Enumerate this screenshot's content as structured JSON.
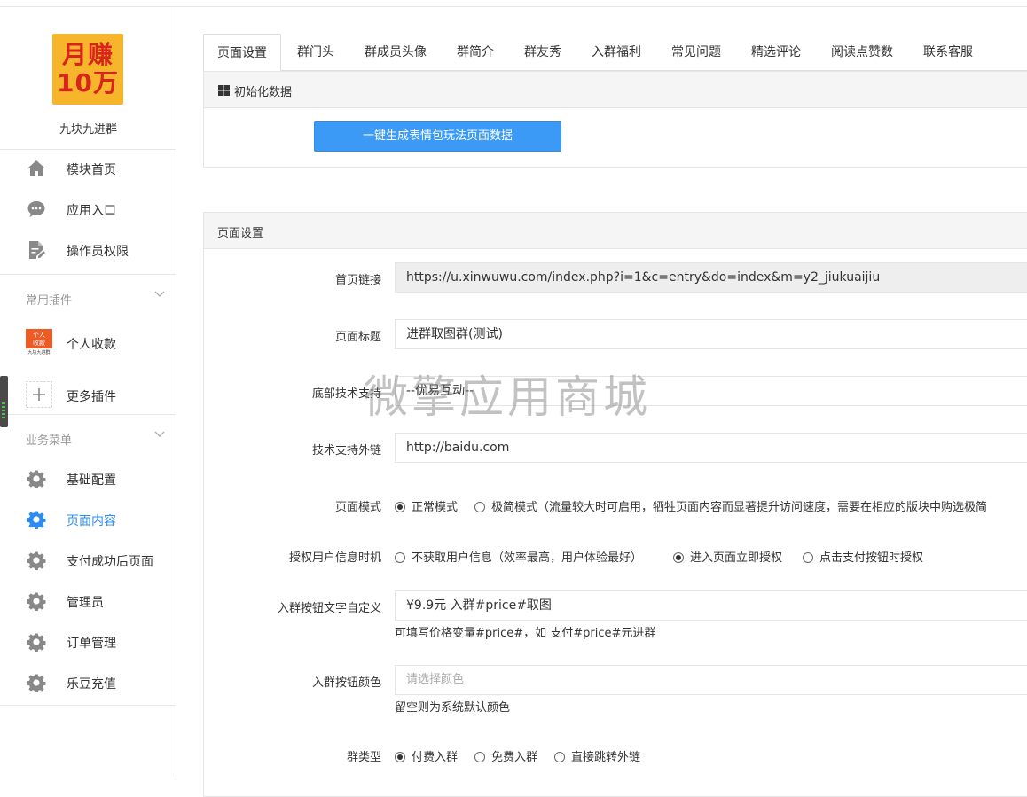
{
  "sidebar": {
    "logo": {
      "line1": "月赚",
      "line2": "10万"
    },
    "brand": "九块九进群",
    "main_items": [
      {
        "label": "模块首页",
        "icon": "home-icon"
      },
      {
        "label": "应用入口",
        "icon": "chat-bubble-icon"
      },
      {
        "label": "操作员权限",
        "icon": "document-edit-icon"
      }
    ],
    "plugins_title": "常用插件",
    "plugins": [
      {
        "label": "个人收款",
        "icon": "personal-payment-icon",
        "icon_text_top": "个人",
        "icon_text_mid": "收款",
        "icon_text_bot": "九块九进群"
      },
      {
        "label": "更多插件",
        "icon": "plus-icon"
      }
    ],
    "business_title": "业务菜单",
    "business_items": [
      {
        "label": "基础配置",
        "icon": "gear-icon",
        "active": false
      },
      {
        "label": "页面内容",
        "icon": "gear-icon",
        "active": true
      },
      {
        "label": "支付成功后页面",
        "icon": "gear-icon",
        "active": false
      },
      {
        "label": "管理员",
        "icon": "gear-icon",
        "active": false
      },
      {
        "label": "订单管理",
        "icon": "gear-icon",
        "active": false
      },
      {
        "label": "乐豆充值",
        "icon": "gear-icon",
        "active": false
      }
    ]
  },
  "tabs": [
    "页面设置",
    "群门头",
    "群成员头像",
    "群简介",
    "群友秀",
    "入群福利",
    "常见问题",
    "精选评论",
    "阅读点赞数",
    "联系客服"
  ],
  "init_panel": {
    "title": "初始化数据",
    "button": "一键生成表情包玩法页面数据"
  },
  "settings_panel": {
    "title": "页面设置",
    "fields": {
      "home_link": {
        "label": "首页链接",
        "value": "https://u.xinwuwu.com/index.php?i=1&c=entry&do=index&m=y2_jiukuaijiu"
      },
      "page_title": {
        "label": "页面标题",
        "value": "进群取图群(测试)"
      },
      "footer_support": {
        "label": "底部技术支持",
        "value": "--优易互动--"
      },
      "support_link": {
        "label": "技术支持外链",
        "value": "http://baidu.com"
      },
      "page_mode": {
        "label": "页面模式",
        "options": [
          "正常模式",
          "极简模式（流量较大时可启用，牺牲页面内容而显著提升访问速度，需要在相应的版块中购选极简"
        ],
        "selected": 0
      },
      "auth_timing": {
        "label": "授权用户信息时机",
        "options": [
          "不获取用户信息（效率最高，用户体验最好）",
          "进入页面立即授权",
          "点击支付按钮时授权"
        ],
        "selected": 1
      },
      "join_text": {
        "label": "入群按钮文字自定义",
        "value": "¥9.9元 入群#price#取图",
        "help": "可填写价格变量#price#，如 支付#price#元进群"
      },
      "join_color": {
        "label": "入群按钮颜色",
        "placeholder": "请选择颜色",
        "help": "留空则为系统默认颜色"
      },
      "group_type": {
        "label": "群类型",
        "options": [
          "付费入群",
          "免费入群",
          "直接跳转外链"
        ],
        "selected": 0
      }
    }
  },
  "watermark": "微擎应用商城",
  "colors": {
    "accent": "#2d8cf0",
    "button": "#3a9af5",
    "logo_bg": "#f7b52c",
    "logo_text": "#d9231c"
  }
}
